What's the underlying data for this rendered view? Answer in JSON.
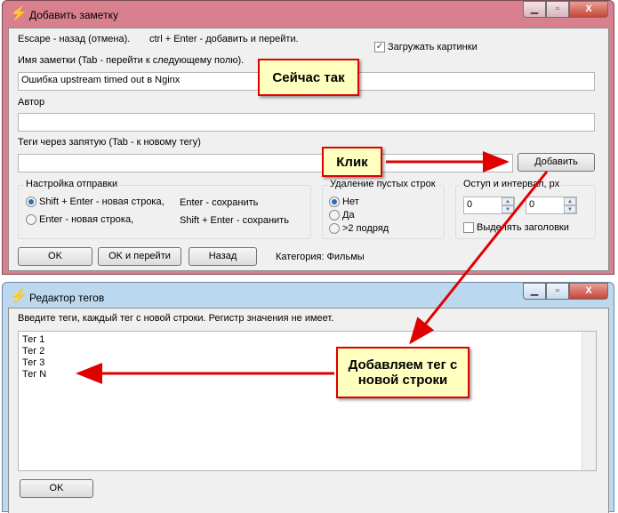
{
  "main_window": {
    "title": "Добавить заметку",
    "hint_escape": "Escape - назад (отмена).",
    "hint_ctrl": "ctrl + Enter - добавить и перейти.",
    "load_images_label": "Загружать картинки",
    "load_images_checked": true,
    "name_label": "Имя заметки (Tab - перейти к следующему полю).",
    "name_value": "Ошибка upstream timed out в Nginx",
    "author_label": "Автор",
    "author_value": "",
    "tags_label": "Теги через запятую (Tab - к новому тегу)",
    "tags_value": "",
    "add_button": "Добавить",
    "send_group": {
      "title": "Настройка отправки",
      "options": [
        {
          "label": "Shift + Enter - новая строка,",
          "extra": "Enter - сохранить",
          "selected": true
        },
        {
          "label": "Enter - новая строка,",
          "extra": "Shift + Enter - сохранить",
          "selected": false
        }
      ]
    },
    "empty_lines_group": {
      "title": "Удаление пустых строк",
      "options": [
        {
          "label": "Нет",
          "selected": true
        },
        {
          "label": "Да",
          "selected": false
        },
        {
          "label": ">2 подряд",
          "selected": false
        }
      ]
    },
    "indent_group": {
      "title": "Оступ и интервал, px",
      "indent": "0",
      "interval": "0",
      "highlight_label": "Выделять заголовки",
      "highlight_checked": false
    },
    "ok_button": "OK",
    "ok_go_button": "OK и перейти",
    "back_button": "Назад",
    "category": "Категория: Фильмы"
  },
  "tag_editor": {
    "title": "Редактор тегов",
    "instruction": "Введите теги, каждый тег с новой строки. Регистр значения не имеет.",
    "tags": [
      "Тег 1",
      "Тег 2",
      "Тег 3",
      "Тег N"
    ],
    "ok_button": "OK"
  },
  "callouts": {
    "now": "Сейчас так",
    "click": "Клик",
    "add_tag": "Добавляем тег с новой строки"
  },
  "colors": {
    "annotation": "#e00000",
    "callout_bg": "#ffffc0"
  }
}
